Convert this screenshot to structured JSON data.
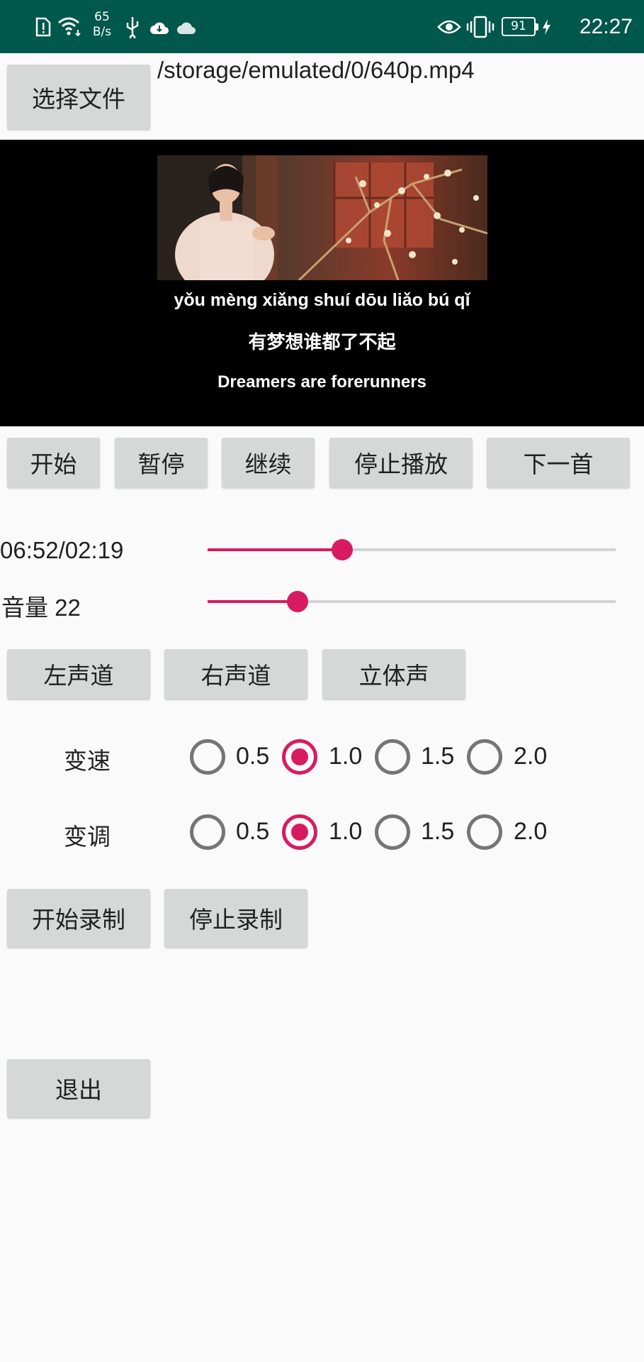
{
  "status_bar": {
    "net_speed_value": "65",
    "net_speed_unit": "B/s",
    "battery": "91",
    "time": "22:27",
    "icons": [
      "sim-alert-icon",
      "wifi-icon",
      "usb-icon",
      "cloud-icon",
      "cloud-outline-icon",
      "eye-comfort-icon",
      "vibrate-icon",
      "battery-icon",
      "charging-icon"
    ],
    "background": "#00574b"
  },
  "file": {
    "select_button": "选择文件",
    "path": "/storage/emulated/0/640p.mp4"
  },
  "video": {
    "pinyin": "yǒu mèng xiǎng shuí dōu liǎo bú qǐ",
    "chinese": "有梦想谁都了不起",
    "english": "Dreamers are forerunners"
  },
  "controls": {
    "start": "开始",
    "pause": "暂停",
    "resume": "继续",
    "stop": "停止播放",
    "next": "下一首"
  },
  "progress": {
    "label": "06:52/02:19",
    "fraction": 0.33
  },
  "volume": {
    "label": "音量 22",
    "fraction": 0.22
  },
  "channels": {
    "left": "左声道",
    "right": "右声道",
    "stereo": "立体声"
  },
  "speed": {
    "label": "变速",
    "options": [
      "0.5",
      "1.0",
      "1.5",
      "2.0"
    ],
    "selected": "1.0"
  },
  "pitch": {
    "label": "变调",
    "options": [
      "0.5",
      "1.0",
      "1.5",
      "2.0"
    ],
    "selected": "1.0"
  },
  "record": {
    "start": "开始录制",
    "stop": "停止录制"
  },
  "exit_label": "退出",
  "accent_color": "#d81b60"
}
